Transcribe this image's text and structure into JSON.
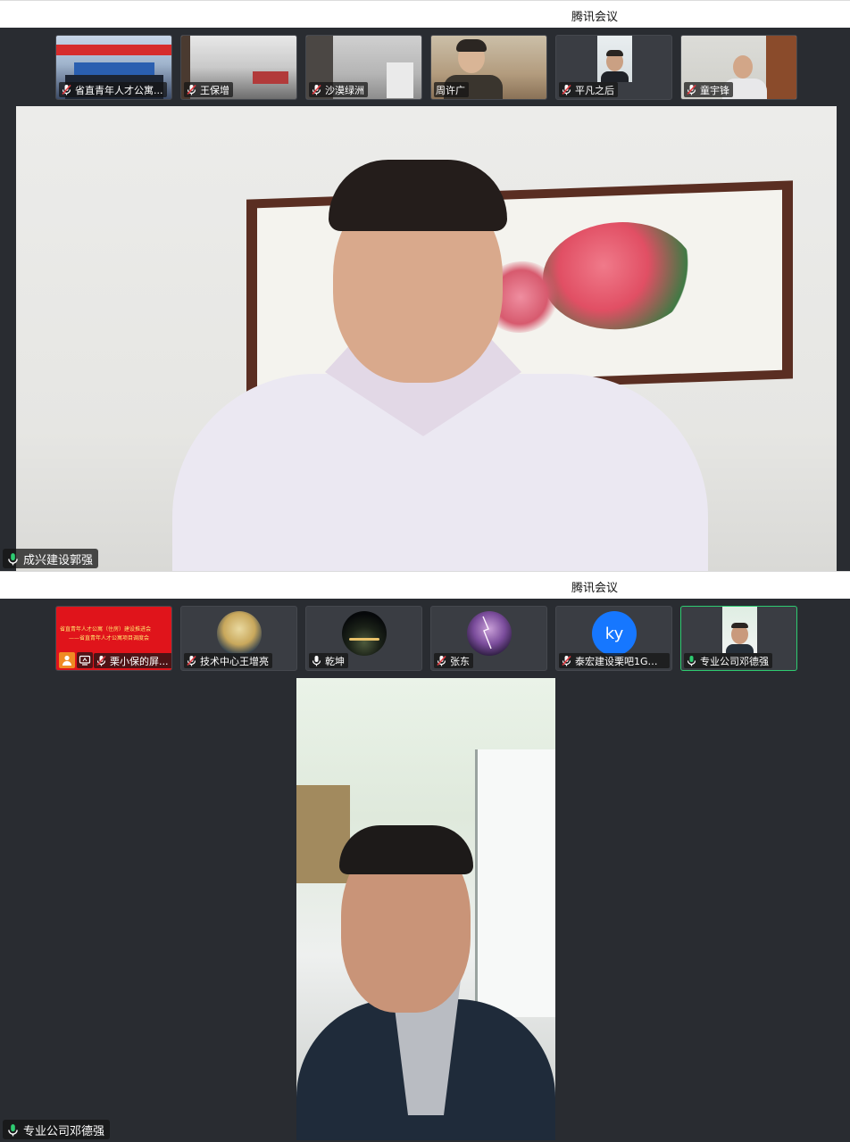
{
  "app_title": "腾讯会议",
  "colors": {
    "accent_green": "#2ecc71",
    "mic_muted_red": "#e0383e",
    "bg_dark": "#292c31",
    "avatar_blue": "#1677ff"
  },
  "top": {
    "participants": [
      {
        "name": "省直青年人才公寓...",
        "mic": "muted"
      },
      {
        "name": "王保增",
        "mic": "muted"
      },
      {
        "name": "沙漠绿洲",
        "mic": "muted"
      },
      {
        "name": "周许广",
        "mic": "none"
      },
      {
        "name": "平凡之后",
        "mic": "muted"
      },
      {
        "name": "童宇锋",
        "mic": "muted"
      }
    ],
    "speaker": {
      "name": "成兴建设郭强",
      "mic": "active"
    }
  },
  "bottom": {
    "participants": [
      {
        "name": "栗小保的屏...",
        "mic": "muted",
        "sharing": true,
        "banner_text_1": "省直青年人才公寓（住房）建设推进会",
        "banner_text_2": "——省直青年人才公寓项目调度会"
      },
      {
        "name": "技术中心王增亮",
        "mic": "muted"
      },
      {
        "name": "乾坤",
        "mic": "on"
      },
      {
        "name": "张东",
        "mic": "muted"
      },
      {
        "name": "泰宏建设栗吧1G你...",
        "mic": "muted",
        "avatar_text": "ky"
      },
      {
        "name": "专业公司邓德强",
        "mic": "active"
      }
    ],
    "speaker": {
      "name": "专业公司邓德强",
      "mic": "active"
    }
  }
}
